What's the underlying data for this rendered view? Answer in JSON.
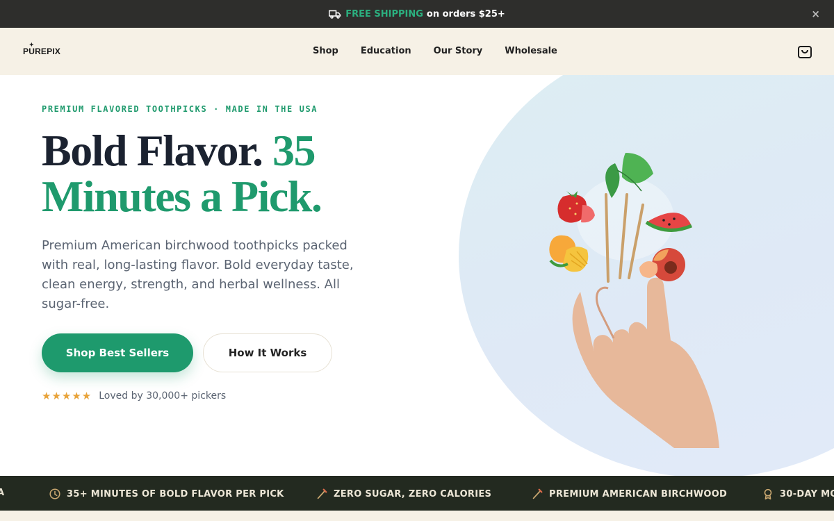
{
  "announcement": {
    "accent_text": "FREE SHIPPING",
    "text": "on orders $25+",
    "icon": "truck-icon",
    "close_label": "×"
  },
  "nav": {
    "logo": "PUREPIX",
    "items": [
      {
        "label": "Shop"
      },
      {
        "label": "Education"
      },
      {
        "label": "Our Story"
      },
      {
        "label": "Wholesale"
      }
    ],
    "cart_icon": "shopping-bag-icon"
  },
  "hero": {
    "eyebrow": "PREMIUM FLAVORED TOOTHPICKS · MADE IN THE USA",
    "headline_dark": "Bold Flavor.",
    "headline_green_1": "35",
    "headline_green_2": "Minutes a Pick.",
    "subtitle": "Premium American birchwood toothpicks packed with real, long-lasting flavor. Bold everyday taste, clean energy, strength, and herbal wellness. All sugar-free.",
    "primary_cta": "Shop Best Sellers",
    "secondary_cta": "How It Works",
    "stars": "★★★★★",
    "rating_text": "Loved by 30,000+ pickers"
  },
  "ticker": {
    "items": [
      {
        "icon": "shield-icon",
        "label": "A"
      },
      {
        "icon": "clock-icon",
        "label": "35+ MINUTES OF BOLD FLAVOR PER PICK"
      },
      {
        "icon": "toothpick-icon",
        "label": "ZERO SUGAR, ZERO CALORIES"
      },
      {
        "icon": "toothpick-icon",
        "label": "PREMIUM AMERICAN BIRCHWOOD"
      },
      {
        "icon": "badge-icon",
        "label": "30-DAY MO"
      }
    ]
  },
  "colors": {
    "accent_green": "#1f9a6d",
    "announcement_bg": "#2e2e2c",
    "nav_bg": "#f6f1e6",
    "ticker_bg": "#232a20",
    "star": "#e8a33a"
  }
}
